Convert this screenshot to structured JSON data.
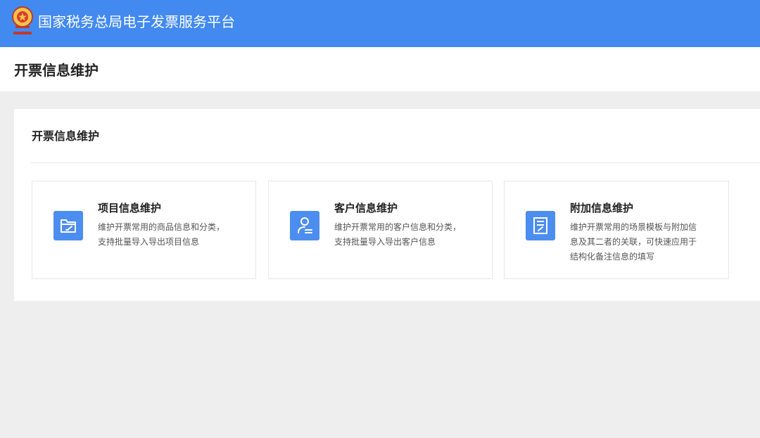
{
  "header": {
    "app_title": "国家税务总局电子发票服务平台",
    "emblem_icon": "tax-emblem-icon"
  },
  "page": {
    "title": "开票信息维护"
  },
  "panel": {
    "title": "开票信息维护",
    "cards": [
      {
        "title": "项目信息维护",
        "desc_lines": [
          "维护开票常用的商品信息和分类，",
          "支持批量导入导出项目信息"
        ],
        "icon": "folder-edit-icon"
      },
      {
        "title": "客户信息维护",
        "desc_lines": [
          "维护开票常用的客户信息和分类，",
          "支持批量导入导出客户信息"
        ],
        "icon": "user-card-icon"
      },
      {
        "title": "附加信息维护",
        "desc_lines": [
          "维护开票常用的场景模板与附加信",
          "息及其二者的关联，可快速应用于",
          "结构化备注信息的填写"
        ],
        "icon": "document-edit-icon"
      }
    ]
  },
  "colors": {
    "topbar": "#4289f0",
    "icon_bg": "#4c8df0",
    "background": "#eeeeee"
  }
}
